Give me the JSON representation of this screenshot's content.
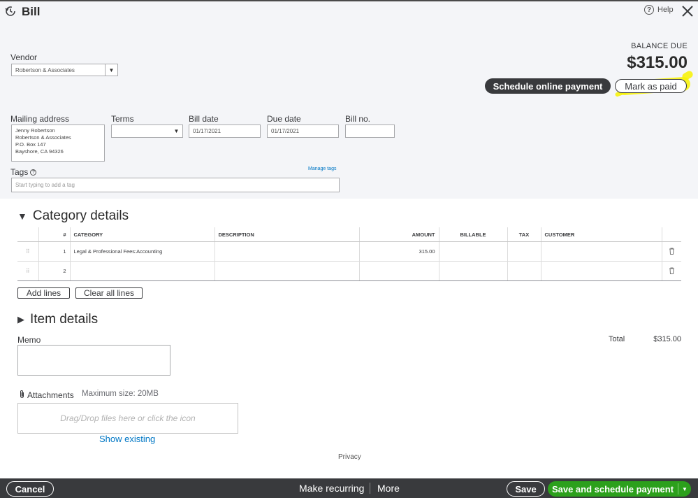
{
  "header": {
    "title": "Bill",
    "help_label": "Help"
  },
  "vendor": {
    "label": "Vendor",
    "value": "Robertson & Associates"
  },
  "balance": {
    "label": "BALANCE DUE",
    "amount": "$315.00",
    "schedule_label": "Schedule online payment",
    "mark_paid_label": "Mark as paid"
  },
  "fields": {
    "mailing_label": "Mailing address",
    "mailing_lines": [
      "Jenny Robertson",
      "Robertson & Associates",
      "P.O. Box 147",
      "Bayshore, CA  94326"
    ],
    "terms_label": "Terms",
    "terms_value": "",
    "bill_date_label": "Bill date",
    "bill_date_value": "01/17/2021",
    "due_date_label": "Due date",
    "due_date_value": "01/17/2021",
    "bill_no_label": "Bill no.",
    "bill_no_value": "",
    "tags_label": "Tags",
    "manage_tags": "Manage tags",
    "tags_placeholder": "Start typing to add a tag"
  },
  "category": {
    "title": "Category details",
    "columns": [
      "#",
      "CATEGORY",
      "DESCRIPTION",
      "AMOUNT",
      "BILLABLE",
      "TAX",
      "CUSTOMER"
    ],
    "rows": [
      {
        "num": "1",
        "category": "Legal & Professional Fees:Accounting",
        "description": "",
        "amount": "315.00",
        "billable": "",
        "tax": "",
        "customer": ""
      },
      {
        "num": "2",
        "category": "",
        "description": "",
        "amount": "",
        "billable": "",
        "tax": "",
        "customer": ""
      }
    ],
    "add_lines": "Add lines",
    "clear_lines": "Clear all lines"
  },
  "item": {
    "title": "Item details"
  },
  "memo": {
    "label": "Memo",
    "value": ""
  },
  "totals": {
    "label": "Total",
    "value": "$315.00"
  },
  "attachments": {
    "label": "Attachments",
    "max_size": "Maximum size: 20MB",
    "drop_text": "Drag/Drop files here or click the icon",
    "show_existing": "Show existing"
  },
  "privacy": "Privacy",
  "footer": {
    "cancel": "Cancel",
    "make_recurring": "Make recurring",
    "more": "More",
    "save": "Save",
    "save_schedule": "Save and schedule payment"
  },
  "colors": {
    "primary_green": "#2ca01c",
    "dark": "#393a3d",
    "highlight": "#f7f200",
    "link": "#0077c5"
  }
}
